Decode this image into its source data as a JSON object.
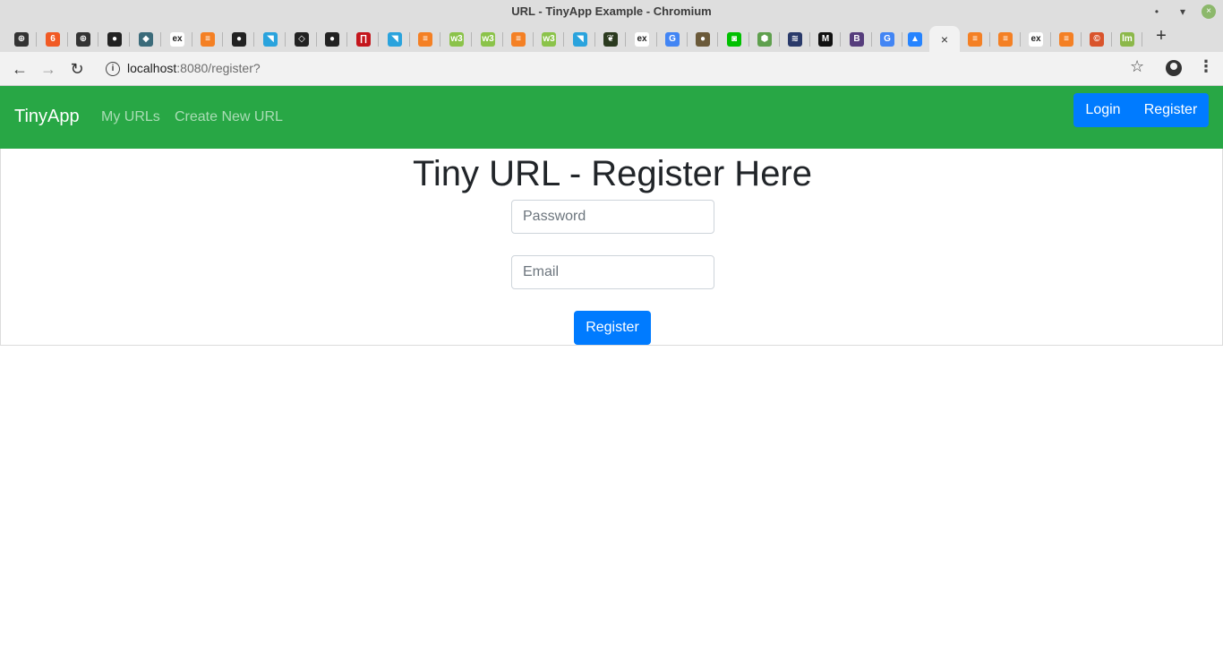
{
  "window": {
    "title": "URL - TinyApp Example - Chromium",
    "minimize": "•",
    "maximize": "▾",
    "close": "×"
  },
  "tabs": [
    {
      "icon": "chrome-icon",
      "glyph": "⊕",
      "color": "#333333"
    },
    {
      "icon": "brave-icon",
      "glyph": "6",
      "color": "#f15a24"
    },
    {
      "icon": "chrome-icon",
      "glyph": "⊕",
      "color": "#333333"
    },
    {
      "icon": "github-icon",
      "glyph": "●",
      "color": "#222222"
    },
    {
      "icon": "shield-icon",
      "glyph": "◆",
      "color": "#3b6b7a"
    },
    {
      "icon": "ex-icon",
      "glyph": "ex",
      "color": "#ffffff"
    },
    {
      "icon": "stackoverflow-icon",
      "glyph": "≡",
      "color": "#f48024"
    },
    {
      "icon": "github-icon",
      "glyph": "●",
      "color": "#222222"
    },
    {
      "icon": "bird-icon",
      "glyph": "◥",
      "color": "#2aa3dd"
    },
    {
      "icon": "codepen-icon",
      "glyph": "◇",
      "color": "#222222"
    },
    {
      "icon": "github-icon",
      "glyph": "●",
      "color": "#222222"
    },
    {
      "icon": "netlify-icon",
      "glyph": "∏",
      "color": "#c4161c"
    },
    {
      "icon": "bird-icon",
      "glyph": "◥",
      "color": "#2aa3dd"
    },
    {
      "icon": "stackoverflow-icon",
      "glyph": "≡",
      "color": "#f48024"
    },
    {
      "icon": "w3-icon",
      "glyph": "w3",
      "color": "#8bc34a"
    },
    {
      "icon": "w3-icon",
      "glyph": "w3",
      "color": "#8bc34a"
    },
    {
      "icon": "stackoverflow-icon",
      "glyph": "≡",
      "color": "#f48024"
    },
    {
      "icon": "w3-icon",
      "glyph": "w3",
      "color": "#8bc34a"
    },
    {
      "icon": "bird-icon",
      "glyph": "◥",
      "color": "#2aa3dd"
    },
    {
      "icon": "mongodb-icon",
      "glyph": "❦",
      "color": "#2b3a1f"
    },
    {
      "icon": "ex-icon",
      "glyph": "ex",
      "color": "#ffffff"
    },
    {
      "icon": "google-icon",
      "glyph": "G",
      "color": "#4285f4"
    },
    {
      "icon": "avatar-icon",
      "glyph": "●",
      "color": "#6b5a3a"
    },
    {
      "icon": "android-icon",
      "glyph": "◙",
      "color": "#00c000"
    },
    {
      "icon": "nodejs-icon",
      "glyph": "⬢",
      "color": "#5fa04e"
    },
    {
      "icon": "stripes-icon",
      "glyph": "≋",
      "color": "#2a3a6a"
    },
    {
      "icon": "medium-icon",
      "glyph": "M",
      "color": "#111111"
    },
    {
      "icon": "bootstrap-icon",
      "glyph": "B",
      "color": "#563d7c"
    },
    {
      "icon": "google-icon",
      "glyph": "G",
      "color": "#4285f4"
    },
    {
      "icon": "atlassian-icon",
      "glyph": "▲",
      "color": "#2684ff"
    },
    {
      "icon": "close-icon",
      "glyph": "×",
      "color": "#333333",
      "active": true
    },
    {
      "icon": "stackoverflow-icon",
      "glyph": "≡",
      "color": "#f48024"
    },
    {
      "icon": "stackoverflow-icon",
      "glyph": "≡",
      "color": "#f48024"
    },
    {
      "icon": "ex-icon",
      "glyph": "ex",
      "color": "#ffffff"
    },
    {
      "icon": "stackoverflow-icon",
      "glyph": "≡",
      "color": "#f48024"
    },
    {
      "icon": "copyright-icon",
      "glyph": "©",
      "color": "#d9542c"
    },
    {
      "icon": "lm-icon",
      "glyph": "lm",
      "color": "#8cb84a"
    }
  ],
  "toolbar": {
    "back": "←",
    "forward": "→",
    "reload": "↻",
    "info": "i",
    "url_host": "localhost",
    "url_path": ":8080/register?",
    "star": "☆",
    "menu": "⋮",
    "new_tab": "+"
  },
  "app": {
    "brand": "TinyApp",
    "nav": {
      "my_urls": "My URLs",
      "create_new_url": "Create New URL",
      "login": "Login",
      "register": "Register"
    },
    "form": {
      "heading": "Tiny URL - Register Here",
      "password_placeholder": "Password",
      "email_placeholder": "Email",
      "submit": "Register"
    }
  },
  "colors": {
    "navbar_bg": "#28a745",
    "primary_button": "#007bff"
  }
}
